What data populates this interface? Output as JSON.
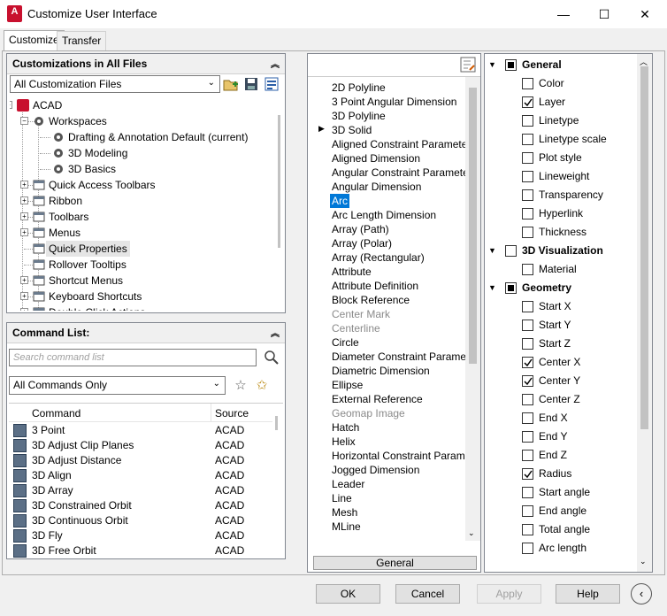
{
  "window": {
    "title": "Customize User Interface",
    "app_icon": "A",
    "minimize": "—",
    "maximize": "☐",
    "close": "✕"
  },
  "tabs": [
    "Customize",
    "Transfer"
  ],
  "custom_panel": {
    "header": "Customizations in All Files",
    "filter": "All Customization Files",
    "tree": [
      {
        "label": "ACAD",
        "level": 0,
        "exp": "−"
      },
      {
        "label": "Workspaces",
        "level": 1,
        "exp": "−"
      },
      {
        "label": "Drafting & Annotation Default (current)",
        "level": 2,
        "exp": ""
      },
      {
        "label": "3D Modeling",
        "level": 2,
        "exp": ""
      },
      {
        "label": "3D Basics",
        "level": 2,
        "exp": ""
      },
      {
        "label": "Quick Access Toolbars",
        "level": 1,
        "exp": "+"
      },
      {
        "label": "Ribbon",
        "level": 1,
        "exp": "+"
      },
      {
        "label": "Toolbars",
        "level": 1,
        "exp": "+"
      },
      {
        "label": "Menus",
        "level": 1,
        "exp": "+"
      },
      {
        "label": "Quick Properties",
        "level": 1,
        "exp": ""
      },
      {
        "label": "Rollover Tooltips",
        "level": 1,
        "exp": ""
      },
      {
        "label": "Shortcut Menus",
        "level": 1,
        "exp": "+"
      },
      {
        "label": "Keyboard Shortcuts",
        "level": 1,
        "exp": "+"
      },
      {
        "label": "Double Click Actions",
        "level": 1,
        "exp": "+"
      }
    ]
  },
  "command_panel": {
    "header": "Command List:",
    "search_placeholder": "Search command list",
    "filter": "All Commands Only",
    "columns": [
      "Command",
      "Source"
    ],
    "rows": [
      {
        "name": "3 Point",
        "source": "ACAD"
      },
      {
        "name": "3D Adjust Clip Planes",
        "source": "ACAD"
      },
      {
        "name": "3D Adjust Distance",
        "source": "ACAD"
      },
      {
        "name": "3D Align",
        "source": "ACAD"
      },
      {
        "name": "3D Array",
        "source": "ACAD"
      },
      {
        "name": "3D Constrained Orbit",
        "source": "ACAD"
      },
      {
        "name": "3D Continuous Orbit",
        "source": "ACAD"
      },
      {
        "name": "3D Fly",
        "source": "ACAD"
      },
      {
        "name": "3D Free Orbit",
        "source": "ACAD"
      }
    ]
  },
  "object_list": {
    "footer": "General",
    "selected": "Arc",
    "items": [
      "2D Polyline",
      "3 Point Angular Dimension",
      "3D Polyline",
      "3D Solid",
      "Aligned Constraint Parameter",
      "Aligned Dimension",
      "Angular Constraint Parameter",
      "Angular Dimension",
      "Arc",
      "Arc Length Dimension",
      "Array (Path)",
      "Array (Polar)",
      "Array (Rectangular)",
      "Attribute",
      "Attribute Definition",
      "Block Reference",
      "Center Mark",
      "Centerline",
      "Circle",
      "Diameter Constraint Paramete",
      "Diametric Dimension",
      "Ellipse",
      "External Reference",
      "Geomap Image",
      "Hatch",
      "Helix",
      "Horizontal Constraint Parame",
      "Jogged Dimension",
      "Leader",
      "Line",
      "Mesh",
      "MLine"
    ],
    "disabled": [
      "Center Mark",
      "Centerline",
      "Geomap Image"
    ],
    "expandable": [
      "3D Solid"
    ]
  },
  "properties": {
    "groups": [
      {
        "name": "General",
        "state": "partial",
        "items": [
          {
            "label": "Color",
            "checked": false
          },
          {
            "label": "Layer",
            "checked": true
          },
          {
            "label": "Linetype",
            "checked": false
          },
          {
            "label": "Linetype scale",
            "checked": false
          },
          {
            "label": "Plot style",
            "checked": false
          },
          {
            "label": "Lineweight",
            "checked": false
          },
          {
            "label": "Transparency",
            "checked": false
          },
          {
            "label": "Hyperlink",
            "checked": false
          },
          {
            "label": "Thickness",
            "checked": false
          }
        ]
      },
      {
        "name": "3D Visualization",
        "state": "none",
        "items": [
          {
            "label": "Material",
            "checked": false
          }
        ]
      },
      {
        "name": "Geometry",
        "state": "partial",
        "items": [
          {
            "label": "Start X",
            "checked": false
          },
          {
            "label": "Start Y",
            "checked": false
          },
          {
            "label": "Start Z",
            "checked": false
          },
          {
            "label": "Center X",
            "checked": true
          },
          {
            "label": "Center Y",
            "checked": true
          },
          {
            "label": "Center Z",
            "checked": false
          },
          {
            "label": "End X",
            "checked": false
          },
          {
            "label": "End Y",
            "checked": false
          },
          {
            "label": "End Z",
            "checked": false
          },
          {
            "label": "Radius",
            "checked": true
          },
          {
            "label": "Start angle",
            "checked": false
          },
          {
            "label": "End angle",
            "checked": false
          },
          {
            "label": "Total angle",
            "checked": false
          },
          {
            "label": "Arc length",
            "checked": false
          }
        ]
      }
    ]
  },
  "buttons": {
    "ok": "OK",
    "cancel": "Cancel",
    "apply": "Apply",
    "help": "Help"
  },
  "colors": {
    "accent": "#0078d7",
    "acad_red": "#c8102e",
    "selection": "#0078d7"
  }
}
